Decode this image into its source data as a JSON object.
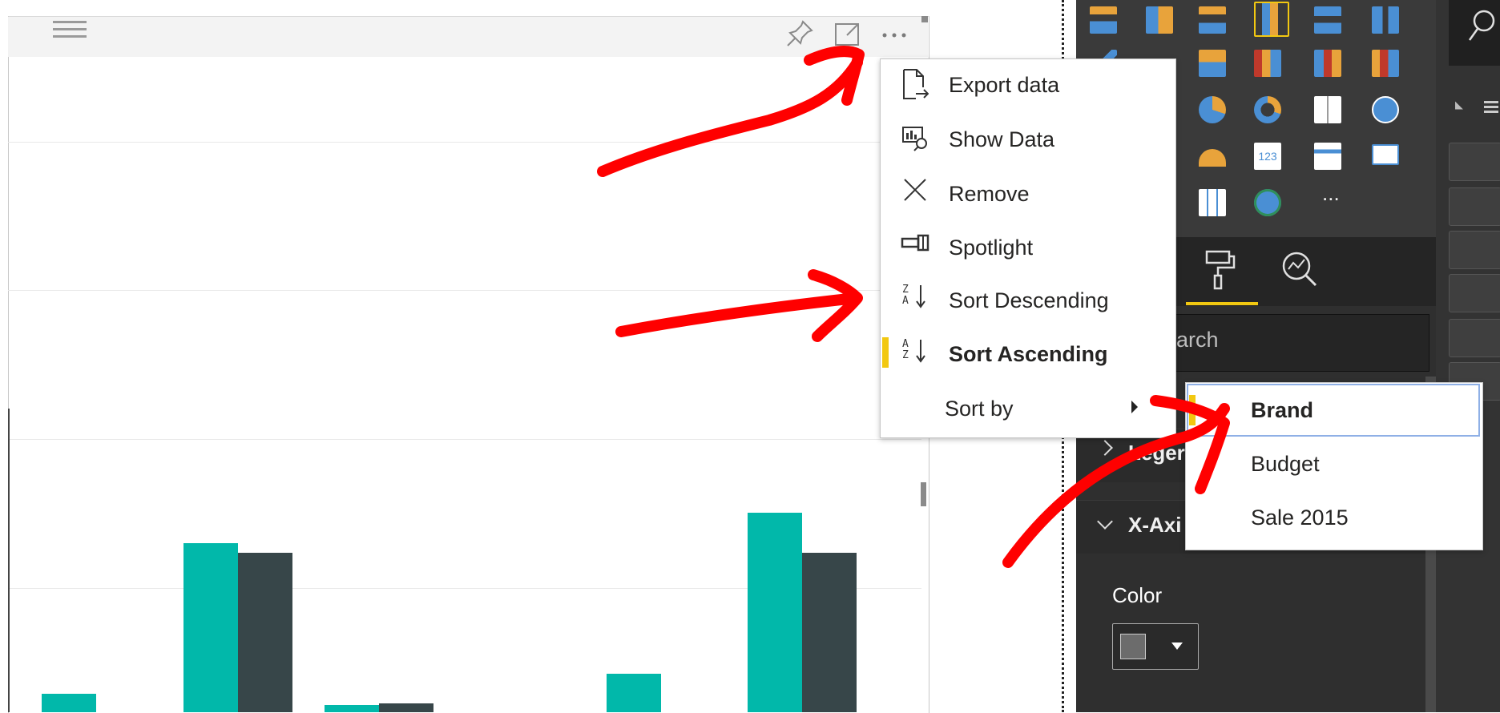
{
  "visual": {
    "header_icons": {
      "drag": "drag-handle-icon",
      "pin": "pin-icon",
      "focus": "focus-mode-icon",
      "more": "more-options-icon"
    },
    "series_colors": {
      "teal": "#01b8aa",
      "dark": "#374649"
    }
  },
  "context_menu": {
    "items": [
      {
        "label": "Export data",
        "icon": "export-data-icon"
      },
      {
        "label": "Show Data",
        "icon": "show-data-icon"
      },
      {
        "label": "Remove",
        "icon": "remove-icon"
      },
      {
        "label": "Spotlight",
        "icon": "spotlight-icon"
      },
      {
        "label": "Sort Descending",
        "icon": "sort-descending-icon",
        "glyph_top": "Z",
        "glyph_bottom": "A"
      },
      {
        "label": "Sort Ascending",
        "icon": "sort-ascending-icon",
        "glyph_top": "A",
        "glyph_bottom": "Z",
        "selected": true
      },
      {
        "label": "Sort by",
        "submenu": true
      }
    ]
  },
  "sort_by_submenu": {
    "items": [
      {
        "label": "Brand",
        "selected": true
      },
      {
        "label": "Budget"
      },
      {
        "label": "Sale 2015"
      }
    ]
  },
  "right_pane": {
    "search_placeholder": "arch",
    "legend_label": "Leger",
    "x_axis_label": "X-Axi",
    "color_label": "Color",
    "gallery_more": "...",
    "tabs": [
      "format-paint-roller-icon",
      "analytics-magnifier-icon"
    ],
    "accent_color": "#f2c811"
  },
  "fields_pane": {
    "search_icon": "search-icon"
  },
  "annotation_color": "#ff0000"
}
